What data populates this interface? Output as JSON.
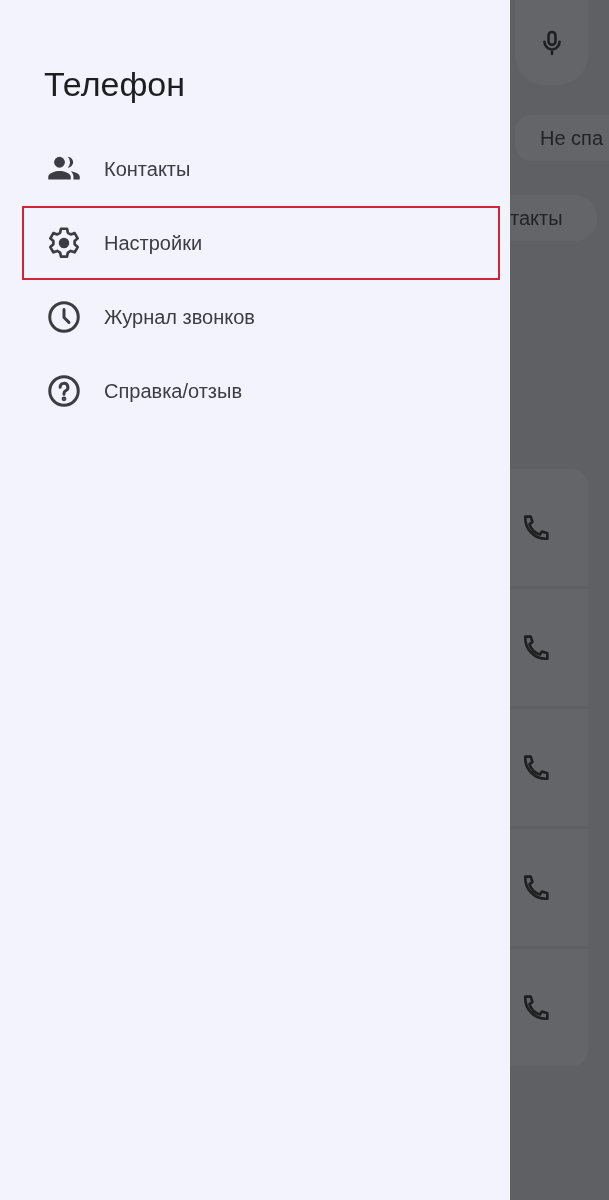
{
  "drawer": {
    "title": "Телефон",
    "items": [
      {
        "label": "Контакты",
        "kind": "people",
        "highlighted": false
      },
      {
        "label": "Настройки",
        "kind": "settings",
        "highlighted": true
      },
      {
        "label": "Журнал звонков",
        "kind": "history",
        "highlighted": false
      },
      {
        "label": "Справка/отзыв",
        "kind": "help",
        "highlighted": false
      }
    ]
  },
  "background": {
    "chips": [
      "Не спа",
      "такты"
    ]
  }
}
